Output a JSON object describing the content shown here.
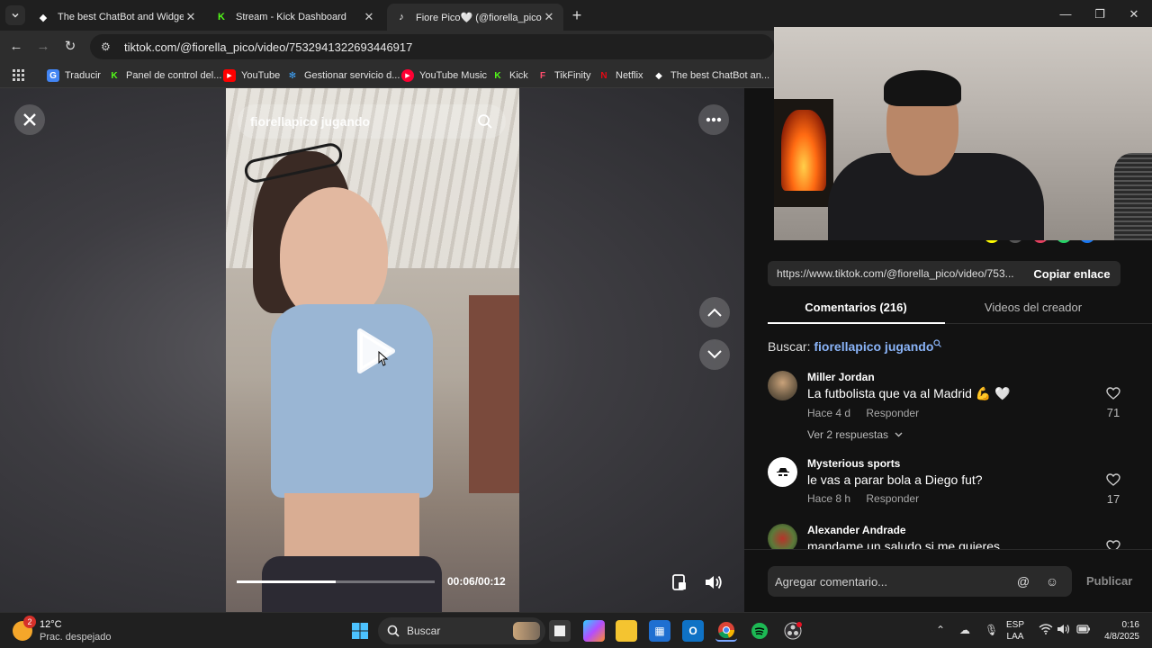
{
  "tabs": [
    {
      "title": "The best ChatBot and Widgets",
      "active": false
    },
    {
      "title": "Stream - Kick Dashboard",
      "active": false
    },
    {
      "title": "Fiore Pico🤍 (@fiorella_pico) |",
      "active": true
    }
  ],
  "address_bar": {
    "url": "tiktok.com/@fiorella_pico/video/7532941322693446917"
  },
  "bookmarks": [
    "Traducir",
    "Panel de control del...",
    "YouTube",
    "Gestionar servicio d...",
    "YouTube Music",
    "Kick",
    "TikFinity",
    "Netflix",
    "The best ChatBot an..."
  ],
  "video": {
    "search_query": "fiorellapico jugando",
    "time": "00:06/00:12",
    "progress_fraction": 0.5
  },
  "panel": {
    "share_url": "https://www.tiktok.com/@fiorella_pico/video/753...",
    "copy_label": "Copiar enlace",
    "tab_comments": "Comentarios (216)",
    "tab_creator_videos": "Videos del creador",
    "search_prefix": "Buscar:",
    "search_term": "fiorellapico jugando",
    "comments": [
      {
        "user": "Miller Jordan",
        "text": "La futbolista que va al Madrid 💪 🤍",
        "time": "Hace 4 d",
        "reply": "Responder",
        "likes": "71",
        "replies": "Ver 2 respuestas"
      },
      {
        "user": "Mysterious sports",
        "text": "le vas a parar bola a Diego fut?",
        "time": "Hace 8 h",
        "reply": "Responder",
        "likes": "17"
      },
      {
        "user": "Alexander Andrade",
        "text": "mandame un saludo si me quieres",
        "time": "",
        "reply": "",
        "likes": ""
      }
    ],
    "comment_placeholder": "Agregar comentario...",
    "publish_label": "Publicar"
  },
  "taskbar": {
    "weather_temp": "12°C",
    "weather_desc": "Prac. despejado",
    "weather_badge": "2",
    "search_label": "Buscar",
    "lang_1": "ESP",
    "lang_2": "LAA",
    "time": "0:16",
    "date": "4/8/2025"
  }
}
